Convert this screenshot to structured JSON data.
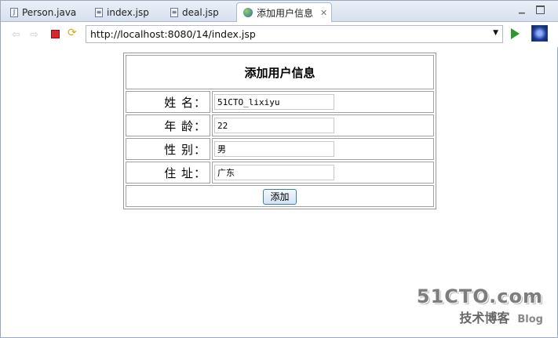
{
  "tabs": [
    {
      "label": "Person.java",
      "icon": "java-file-icon"
    },
    {
      "label": "index.jsp",
      "icon": "jsp-file-icon"
    },
    {
      "label": "deal.jsp",
      "icon": "jsp-file-icon"
    },
    {
      "label": "添加用户信息",
      "icon": "globe-icon",
      "active": true
    }
  ],
  "toolbar": {
    "url": "http://localhost:8080/14/index.jsp"
  },
  "form": {
    "title": "添加用户信息",
    "fields": [
      {
        "label": "姓 名：",
        "value": "51CTO_lixiyu"
      },
      {
        "label": "年 龄：",
        "value": "22"
      },
      {
        "label": "性 别：",
        "value": "男"
      },
      {
        "label": "住 址：",
        "value": "广东"
      }
    ],
    "submit_label": "添加"
  },
  "watermark": {
    "site": "51CTO.com",
    "sub": "技术博客",
    "blog": "Blog"
  }
}
